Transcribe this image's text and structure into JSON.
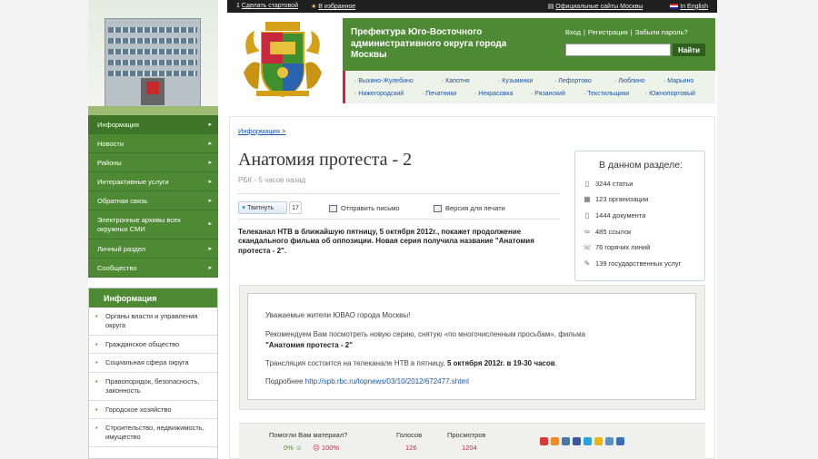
{
  "topbar": {
    "make_home": "Сделать стартовой",
    "favorites": "В избранное",
    "official_sites": "Официальные сайты Москвы",
    "english": "In English"
  },
  "header": {
    "org_title": "Префектура Юго-Восточного административного округа города Москвы",
    "login": "Вход",
    "register": "Регистрация",
    "forgot": "Забыли пароль?",
    "search_placeholder": "",
    "search_button": "Найти"
  },
  "districts": [
    "Выхино-Жулебино",
    "Капотня",
    "Кузьминки",
    "Лефортово",
    "Люблино",
    "Марьино",
    "Нижегородский",
    "Печатники",
    "Некрасовка",
    "Рязанский",
    "Текстильщики",
    "Южнопортовый"
  ],
  "leftnav": {
    "items": [
      "Информация",
      "Новости",
      "Районы",
      "Интерактивные услуги",
      "Обратная связь",
      "Электронные архивы всех окружных СМИ",
      "Личный раздел",
      "Сообщество"
    ]
  },
  "info_box": {
    "title": "Информация",
    "items": [
      "Органы власти и управления округа",
      "Гражданское общество",
      "Социальная сфера округа",
      "Правопорядок, безопасность, законность",
      "Городское хозяйство",
      "Строительство, недвижимость, имущество"
    ]
  },
  "article": {
    "breadcrumb": "Информация",
    "breadcrumb_sep": ">",
    "title": "Анатомия протеста - 2",
    "source": "РБК - 5 часов назад",
    "tweet_label": "Твитнуть",
    "tweet_count": "17",
    "send_email": "Отправить письмо",
    "print_version": "Версия для печати",
    "lead": "Телеканал НТВ в ближайшую пятницу, 5 октября 2012г., покажет продолжение скандального фильма об оппозиции. Новая серия получила название \"Анатомия протеста - 2\"."
  },
  "section": {
    "title": "В данном разделе:",
    "stats": [
      "3244 статьи",
      "123 организации",
      "1444 документа",
      "485 ссылок",
      "76 горячих линий",
      "139 государственных услуг"
    ]
  },
  "notice": {
    "greeting": "Уважаемые жители ЮВАО города Москвы!",
    "line1": "Рекомендуем Вам посмотреть новую серию, снятую «по многочисленным просьбам», фильма",
    "film": "\"Анатомия протеста - 2\"",
    "broadcast_prefix": "Трансляция состоится на телеканале НТВ в пятницу,",
    "broadcast_date": "5 октября 2012г. в 19-30 часов",
    "more_prefix": "Подробнее",
    "more_link": "http://spb.rbc.ru/topnews/03/10/2012/672477.shtml"
  },
  "rating": {
    "helpful_q": "Помогли Вам материал?",
    "yes_pct": "0%",
    "no_pct": "100%",
    "votes_label": "Голосов",
    "votes": "126",
    "views_label": "Просмотров",
    "views": "1204"
  },
  "colors": {
    "brand_green": "#4e8a34",
    "accent_red": "#c8283c",
    "link_blue": "#1a55a8"
  }
}
